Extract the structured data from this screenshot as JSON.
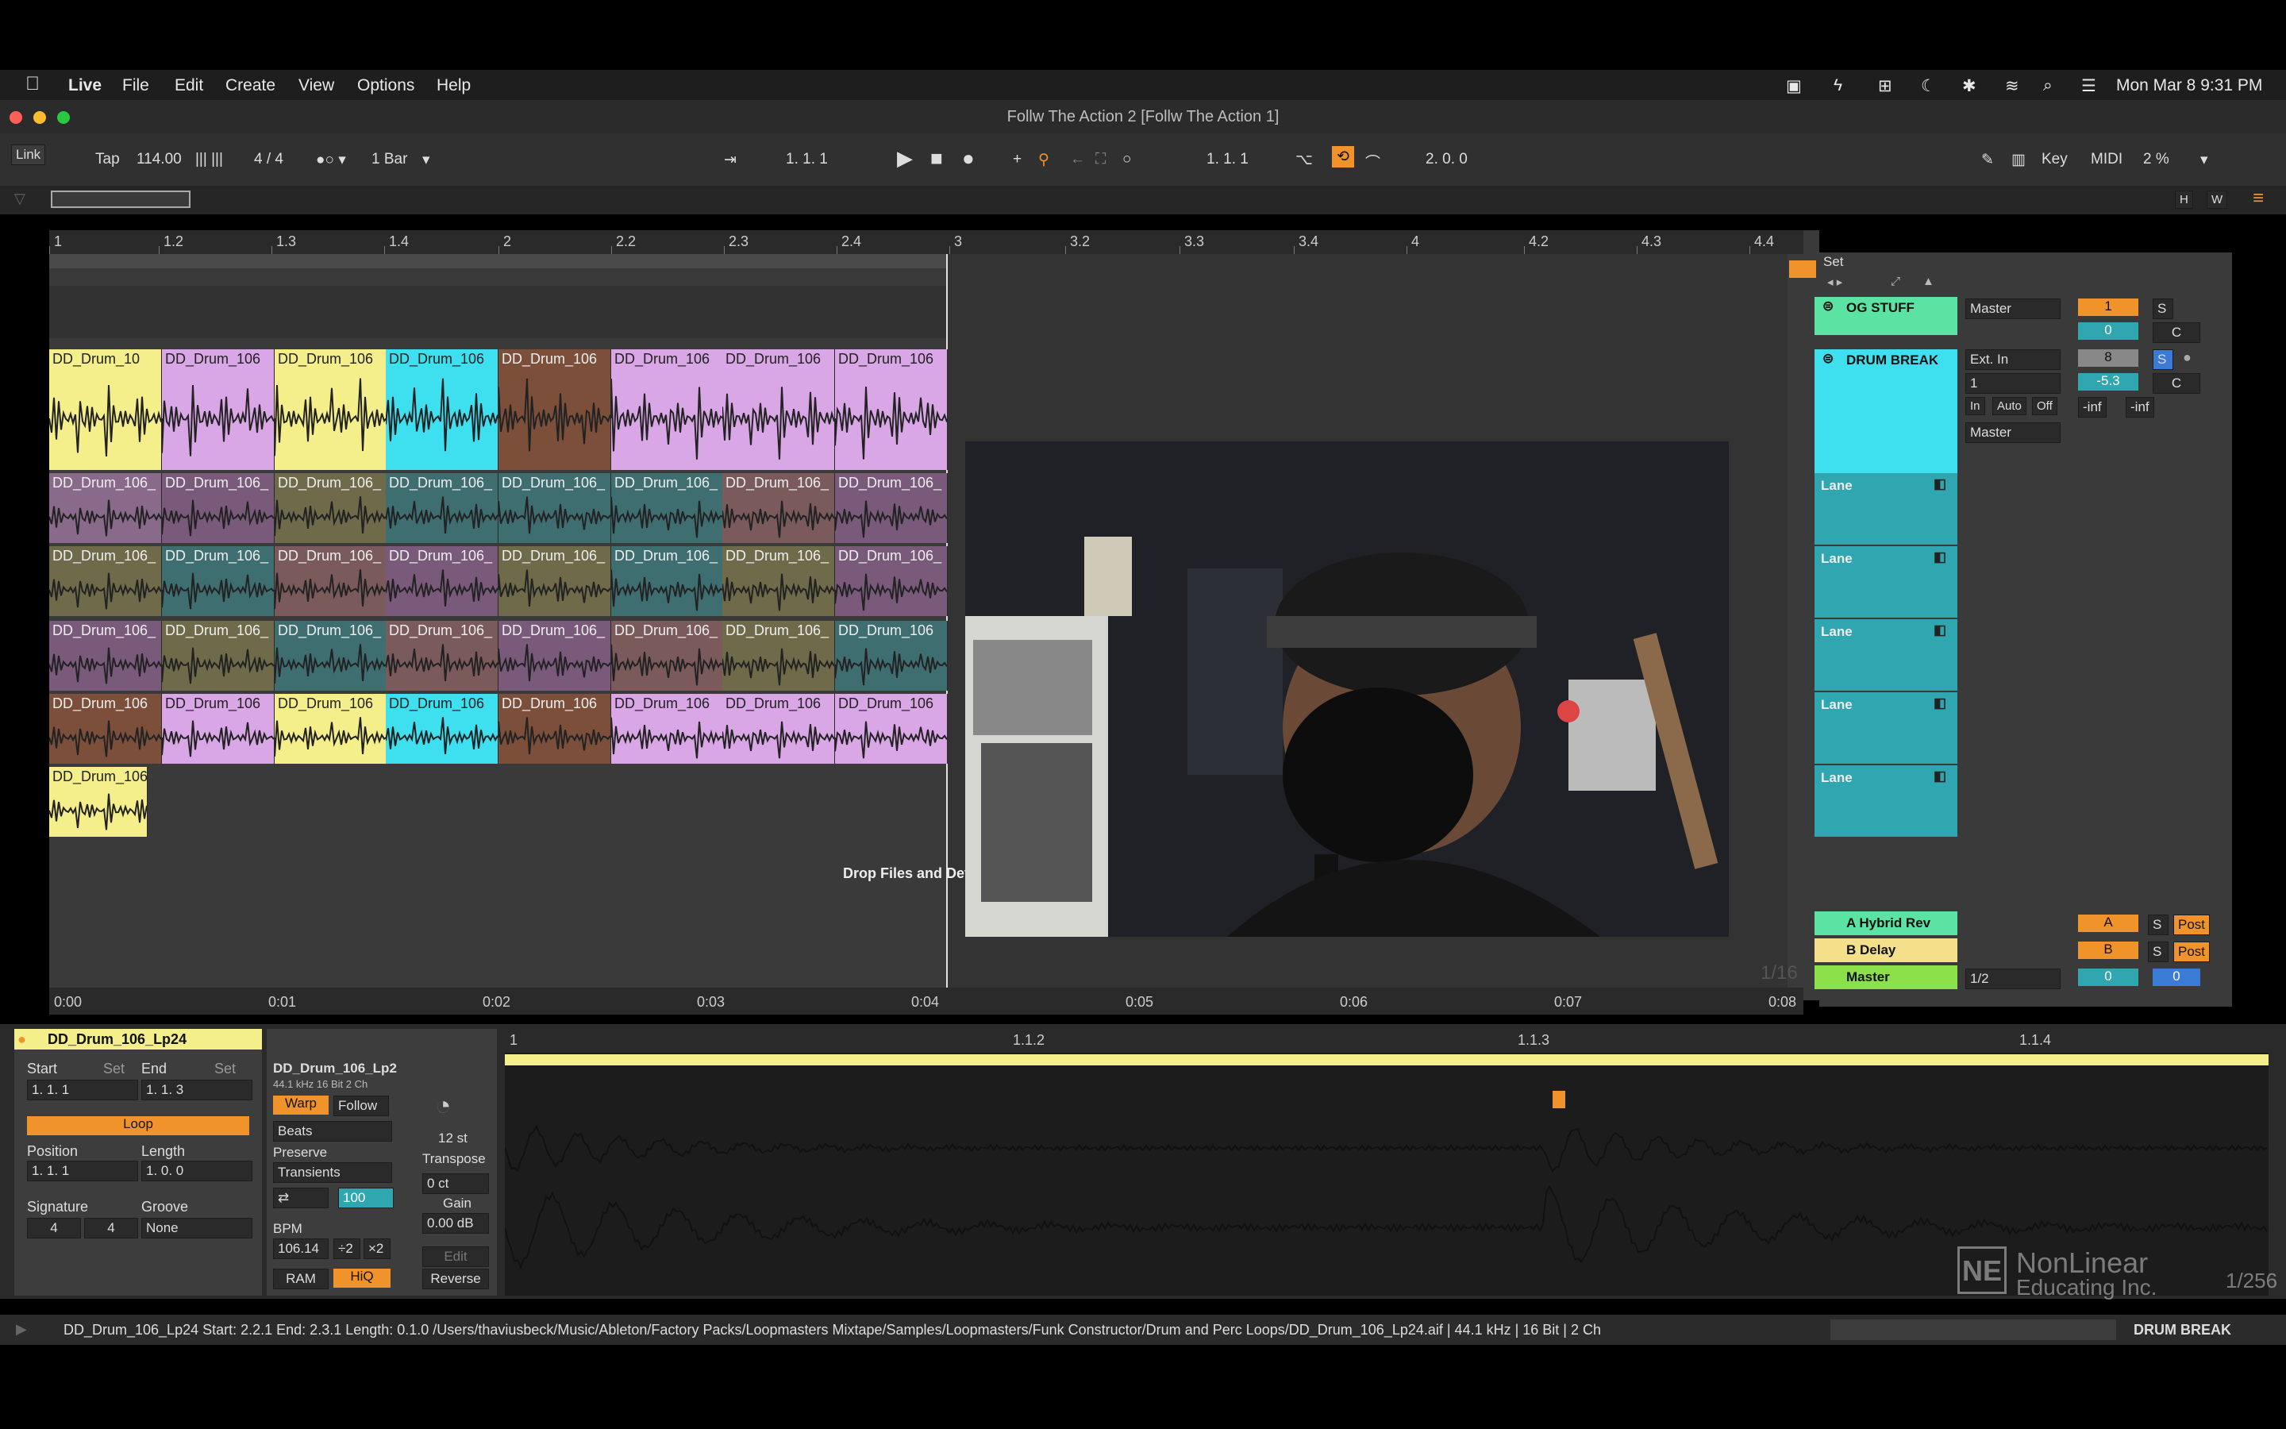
{
  "menubar": {
    "apple": "",
    "items": [
      "Live",
      "File",
      "Edit",
      "Create",
      "View",
      "Options",
      "Help"
    ],
    "clock": "Mon Mar 8  9:31 PM"
  },
  "window": {
    "title": "Follw The Action 2  [Follw The Action 1]"
  },
  "transport": {
    "link": "Link",
    "tap": "Tap",
    "tempo": "114.00",
    "signature": "4 / 4",
    "quantize": "1 Bar",
    "position": "1.   1.   1",
    "loop_start": "1.   1.   1",
    "loop_length": "2.   0.   0",
    "key": "Key",
    "midi": "MIDI",
    "cpu": "2 %"
  },
  "overview": {
    "h": "H",
    "w": "W"
  },
  "ruler": {
    "bars": [
      "1",
      "1.2",
      "1.3",
      "1.4",
      "2",
      "2.2",
      "2.3",
      "2.4",
      "3",
      "3.2",
      "3.3",
      "3.4",
      "4",
      "4.2",
      "4.3",
      "4.4"
    ]
  },
  "time": {
    "labels": [
      "0:00",
      "0:01",
      "0:02",
      "0:03",
      "0:04",
      "0:05",
      "0:06",
      "0:07",
      "0:08"
    ],
    "zoom": "1/16"
  },
  "clips": {
    "row1": [
      "DD_Drum_10",
      "DD_Drum_106",
      "DD_Drum_106",
      "DD_Drum_106",
      "DD_Drum_106",
      "DD_Drum_106",
      "DD_Drum_106",
      "DD_Drum_106"
    ],
    "lane1": [
      "DD_Drum_106_",
      "DD_Drum_106_",
      "DD_Drum_106_",
      "DD_Drum_106_",
      "DD_Drum_106_",
      "DD_Drum_106_",
      "DD_Drum_106_",
      "DD_Drum_106_"
    ],
    "lane2": [
      "DD_Drum_106_",
      "DD_Drum_106_",
      "DD_Drum_106_",
      "DD_Drum_106_",
      "DD_Drum_106_",
      "DD_Drum_106_",
      "DD_Drum_106_",
      "DD_Drum_106_"
    ],
    "lane3": [
      "DD_Drum_106_",
      "DD_Drum_106_",
      "DD_Drum_106_",
      "DD_Drum_106_",
      "DD_Drum_106_",
      "DD_Drum_106_",
      "DD_Drum_106_",
      "DD_Drum_106"
    ],
    "lane4": [
      "DD_Drum_106",
      "DD_Drum_106",
      "DD_Drum_106",
      "DD_Drum_106",
      "DD_Drum_106",
      "DD_Drum_106",
      "DD_Drum_106",
      "DD_Drum_106"
    ],
    "lane5": [
      "DD_Drum_106"
    ]
  },
  "drop_text": "Drop Files and Dev",
  "tracks": {
    "set": "Set",
    "og": {
      "name": "OG STUFF",
      "out": "Master",
      "num": "1",
      "s": "S",
      "vol": "0",
      "pan": "C"
    },
    "drum": {
      "name": "DRUM BREAK",
      "in": "Ext. In",
      "ch": "1",
      "num": "8",
      "s": "S",
      "vol": "-5.3",
      "pan": "C",
      "mon_in": "In",
      "mon_auto": "Auto",
      "mon_off": "Off",
      "out": "Master",
      "peak1": "-inf",
      "peak2": "-inf"
    },
    "lanes": [
      "Lane",
      "Lane",
      "Lane",
      "Lane",
      "Lane"
    ],
    "returns": [
      {
        "name": "A Hybrid Rev",
        "num": "A",
        "s": "S",
        "post": "Post"
      },
      {
        "name": "B Delay",
        "num": "B",
        "s": "S",
        "post": "Post"
      }
    ],
    "master": {
      "name": "Master",
      "io": "1/2",
      "vol": "0",
      "vol2": "0"
    }
  },
  "clip": {
    "name": "DD_Drum_106_Lp24",
    "start_label": "Start",
    "end_label": "End",
    "set": "Set",
    "start": "1.   1.   1",
    "end": "1.   1.   3",
    "loop": "Loop",
    "position_label": "Position",
    "length_label": "Length",
    "position": "1.   1.   1",
    "length": "1.   0.   0",
    "signature_label": "Signature",
    "groove_label": "Groove",
    "sig_num": "4",
    "sig_den": "4",
    "groove": "None"
  },
  "sample": {
    "name": "DD_Drum_106_Lp2",
    "info": "44.1 kHz  16 Bit  2 Ch",
    "warp": "Warp",
    "follow": "Follow",
    "mode": "Beats",
    "preserve_label": "Preserve",
    "preserve": "Transients",
    "loop_mode": "⇄",
    "amount": "100",
    "bpm_label": "BPM",
    "bpm": "106.14",
    "half": "÷2",
    "double": "×2",
    "ram": "RAM",
    "hiq": "HiQ",
    "transpose_val": "12 st",
    "transpose": "Transpose",
    "detune": "0 ct",
    "gain_label": "Gain",
    "gain": "0.00 dB",
    "edit": "Edit",
    "reverse": "Reverse"
  },
  "wave": {
    "marks": [
      "1",
      "1.1.2",
      "1.1.3",
      "1.1.4"
    ]
  },
  "status": {
    "text": "DD_Drum_106_Lp24  Start: 2.2.1  End: 2.3.1  Length: 0.1.0  /Users/thaviusbeck/Music/Ableton/Factory Packs/Loopmasters Mixtape/Samples/Loopmasters/Funk Constructor/Drum and Perc Loops/DD_Drum_106_Lp24.aif | 44.1 kHz | 16 Bit | 2 Ch",
    "track": "DRUM BREAK"
  },
  "watermark": {
    "line1": "NonLinear",
    "line2": "Educating Inc.",
    "page": "1/256"
  },
  "colors": {
    "yellow": "#f4ef8a",
    "pink": "#d9a6e6",
    "cyan": "#3ee0f0",
    "brown": "#7b4f3a",
    "green": "#5be3a3",
    "orange": "#f0932b",
    "teal": "#2fa6b0"
  }
}
